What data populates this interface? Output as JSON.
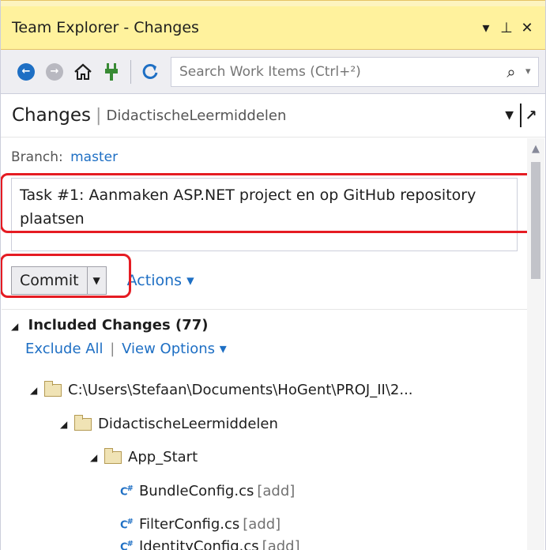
{
  "window": {
    "title": "Team Explorer - Changes",
    "pin_glyph": "⊥",
    "close_glyph": "✕",
    "menu_glyph": "▾"
  },
  "toolbar": {
    "search_placeholder": "Search Work Items (Ctrl+²)",
    "icons": [
      "back-icon",
      "forward-icon",
      "home-icon",
      "connect-icon",
      "refresh-icon",
      "search-icon"
    ]
  },
  "page": {
    "title": "Changes",
    "repo": "DidactischeLeermiddelen"
  },
  "branch": {
    "label": "Branch:",
    "value": "master"
  },
  "commit_message": "Task #1: Aanmaken ASP.NET project en op GitHub repository plaatsen",
  "commit": {
    "button_label": "Commit",
    "actions_label": "Actions ▾"
  },
  "included": {
    "title": "Included Changes (77)",
    "exclude_all": "Exclude All",
    "view_options": "View Options ▾"
  },
  "tree": {
    "root": "C:\\Users\\Stefaan\\Documents\\HoGent\\PROJ_II\\2...",
    "project": "DidactischeLeermiddelen",
    "folder": "App_Start",
    "files": [
      {
        "name": "BundleConfig.cs",
        "status": "[add]"
      },
      {
        "name": "FilterConfig.cs",
        "status": "[add]"
      },
      {
        "name": "IdentityConfig.cs",
        "status": "[add]"
      }
    ]
  },
  "colors": {
    "accent": "#1e6fc4",
    "highlight": "#e51c23",
    "title_bar": "#fff29d"
  }
}
